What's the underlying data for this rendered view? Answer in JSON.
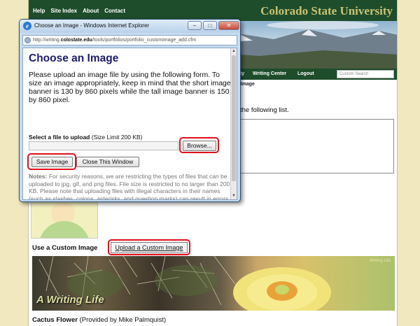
{
  "site": {
    "topnav": [
      "Help",
      "Site Index",
      "About",
      "Contact"
    ],
    "university": "Colorado State University",
    "greennav": {
      "item_partial": "ity",
      "writing_center": "Writing Center",
      "logout": "Logout",
      "search_placeholder": "Custom Search"
    },
    "subtitle_partial": "r Image",
    "instructions_partial": "the following list.",
    "custom_image_label": "Use a Custom Image",
    "upload_button": "Upload a Custom Image",
    "banner_text": "A Writing Life",
    "banner_small": "Writing Life",
    "caption_title": "Cactus Flower",
    "caption_credit": "(Provided by Mike Palmquist)"
  },
  "popup": {
    "window_title": "Choose an Image - Windows Internet Explorer",
    "address_prefix": "http://writing.",
    "address_domain": "colostate.edu",
    "address_suffix": "/tools/portfolios/portfolio_customimage_add.cfm",
    "heading": "Choose an Image",
    "paragraph": "Please upload an image file by using the following form. To size an image appropriately, keep in mind that the short image banner is 130 by 860 pixels while the tall image banner is 150 by 860 pixel.",
    "file_label": "Select a file to upload",
    "size_limit": "(Size Limit 200 KB)",
    "browse_button": "Browse...",
    "save_button": "Save Image",
    "close_button": "Close This Window",
    "notes_label": "Notes:",
    "notes_text": "For security reasons, we are restricting the types of files that can be uploaded to jpg, gif, and png files. File size is restricted to no larger than 200 KB. Please note that uploading files with illegal characters in their names (such as slashes, colons, asterisks, and question marks) can result in errors.",
    "controls": {
      "minimize": "–",
      "maximize": "□",
      "close": "✕"
    }
  },
  "colors": {
    "csu_green": "#1e4d2b",
    "csu_gold": "#c8c372",
    "highlight_red": "#e0101a",
    "heading_navy": "#1c1c6e",
    "page_background": "#f2e8bf"
  },
  "icons": [
    "ie-logo-icon",
    "page-icon",
    "minimize-icon",
    "maximize-icon",
    "close-icon",
    "scroll-up-icon",
    "scroll-down-icon"
  ]
}
